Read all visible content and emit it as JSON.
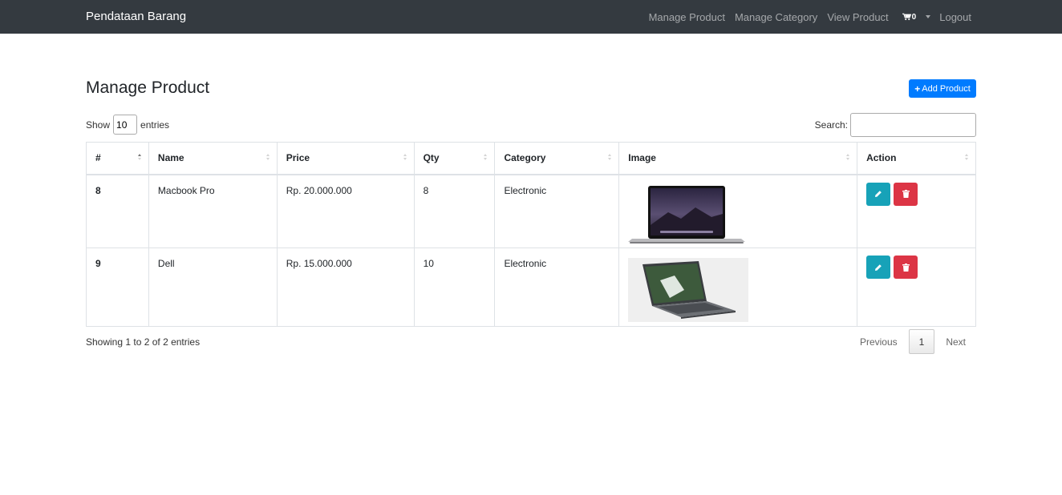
{
  "navbar": {
    "brand": "Pendataan Barang",
    "links": [
      "Manage Product",
      "Manage Category",
      "View Product"
    ],
    "cart_count": "0",
    "logout": "Logout"
  },
  "page": {
    "title": "Manage Product",
    "add_button": "Add Product"
  },
  "table_controls": {
    "show_label": "Show",
    "entries_value": "10",
    "entries_label": "entries",
    "search_label": "Search:",
    "search_value": ""
  },
  "table": {
    "columns": [
      "#",
      "Name",
      "Price",
      "Qty",
      "Category",
      "Image",
      "Action"
    ],
    "rows": [
      {
        "id": "8",
        "name": "Macbook Pro",
        "price": "Rp. 20.000.000",
        "qty": "8",
        "category": "Electronic",
        "image": "macbook-laptop-image"
      },
      {
        "id": "9",
        "name": "Dell",
        "price": "Rp. 15.000.000",
        "qty": "10",
        "category": "Electronic",
        "image": "dell-laptop-image"
      }
    ]
  },
  "footer": {
    "info": "Showing 1 to 2 of 2 entries",
    "previous": "Previous",
    "page": "1",
    "next": "Next"
  },
  "colors": {
    "navbar": "#343a40",
    "primary": "#007bff",
    "info": "#17a2b8",
    "danger": "#dc3545"
  },
  "icons": {
    "cart": "shopping-cart-icon",
    "plus": "plus-icon",
    "edit": "pencil-icon",
    "delete": "trash-icon"
  }
}
